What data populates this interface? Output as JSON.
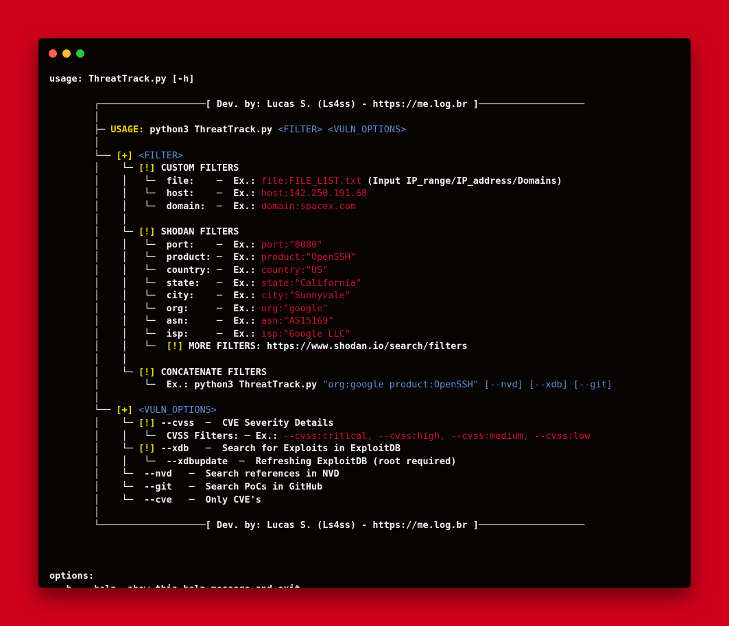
{
  "window": {
    "controls": [
      "close",
      "minimize",
      "zoom"
    ],
    "colors": {
      "close": "#ff5f57",
      "minimize": "#febc2e",
      "zoom": "#28c840"
    }
  },
  "colors": {
    "background": "#d0021b",
    "terminal": "#070302",
    "text": "#f4f4f4",
    "yellow": "#f5d90a",
    "blue": "#5a8fd6",
    "red": "#c8142c"
  },
  "terminal": {
    "lines": [
      [
        {
          "t": "usage: ThreatTrack.py [-h]",
          "c": "default"
        }
      ],
      [],
      [
        {
          "t": "        ┌───────────────────[ Dev. by: Lucas S. (Ls4ss) - https://me.log.br ]───────────────────",
          "c": "default"
        }
      ],
      [
        {
          "t": "        │",
          "c": "default"
        }
      ],
      [
        {
          "t": "        ├─ ",
          "c": "default"
        },
        {
          "t": "USAGE:",
          "c": "yellow"
        },
        {
          "t": " python3 ThreatTrack.py ",
          "c": "default"
        },
        {
          "t": "<FILTER> <VULN_OPTIONS>",
          "c": "blue"
        }
      ],
      [
        {
          "t": "        │",
          "c": "default"
        }
      ],
      [
        {
          "t": "        └── ",
          "c": "default"
        },
        {
          "t": "[+]",
          "c": "yellow"
        },
        {
          "t": " ",
          "c": "default"
        },
        {
          "t": "<FILTER>",
          "c": "blue"
        }
      ],
      [
        {
          "t": "        │    └─ ",
          "c": "default"
        },
        {
          "t": "[!]",
          "c": "yellow"
        },
        {
          "t": " CUSTOM FILTERS",
          "c": "default"
        }
      ],
      [
        {
          "t": "        │    │   └─  file:    ─  Ex.: ",
          "c": "default"
        },
        {
          "t": "file:FILE_LIST.txt",
          "c": "red"
        },
        {
          "t": " (Input IP_range/IP_address/Domains)",
          "c": "default"
        }
      ],
      [
        {
          "t": "        │    │   └─  host:    ─  Ex.: ",
          "c": "default"
        },
        {
          "t": "host:142.250.191.68",
          "c": "red"
        }
      ],
      [
        {
          "t": "        │    │   └─  domain:  ─  Ex.: ",
          "c": "default"
        },
        {
          "t": "domain:spacex.com",
          "c": "red"
        }
      ],
      [
        {
          "t": "        │    │",
          "c": "default"
        }
      ],
      [
        {
          "t": "        │    └─ ",
          "c": "default"
        },
        {
          "t": "[!]",
          "c": "yellow"
        },
        {
          "t": " SHODAN FILTERS",
          "c": "default"
        }
      ],
      [
        {
          "t": "        │    │   └─  port:    ─  Ex.: ",
          "c": "default"
        },
        {
          "t": "port:\"8080\"",
          "c": "red"
        }
      ],
      [
        {
          "t": "        │    │   └─  product: ─  Ex.: ",
          "c": "default"
        },
        {
          "t": "product:\"OpenSSH\"",
          "c": "red"
        }
      ],
      [
        {
          "t": "        │    │   └─  country: ─  Ex.: ",
          "c": "default"
        },
        {
          "t": "country:\"US\"",
          "c": "red"
        }
      ],
      [
        {
          "t": "        │    │   └─  state:   ─  Ex.: ",
          "c": "default"
        },
        {
          "t": "state:\"California\"",
          "c": "red"
        }
      ],
      [
        {
          "t": "        │    │   └─  city:    ─  Ex.: ",
          "c": "default"
        },
        {
          "t": "city:\"Sunnyvale\"",
          "c": "red"
        }
      ],
      [
        {
          "t": "        │    │   └─  org:     ─  Ex.: ",
          "c": "default"
        },
        {
          "t": "org:\"google\"",
          "c": "red"
        }
      ],
      [
        {
          "t": "        │    │   └─  asn:     ─  Ex.: ",
          "c": "default"
        },
        {
          "t": "asn:\"AS15169\"",
          "c": "red"
        }
      ],
      [
        {
          "t": "        │    │   └─  isp:     ─  Ex.: ",
          "c": "default"
        },
        {
          "t": "isp:\"Google LLC\"",
          "c": "red"
        }
      ],
      [
        {
          "t": "        │    │   └─  ",
          "c": "default"
        },
        {
          "t": "[!]",
          "c": "yellow"
        },
        {
          "t": " MORE FILTERS: https://www.shodan.io/search/filters",
          "c": "default"
        }
      ],
      [
        {
          "t": "        │    │",
          "c": "default"
        }
      ],
      [
        {
          "t": "        │    └─ ",
          "c": "default"
        },
        {
          "t": "[!]",
          "c": "yellow"
        },
        {
          "t": " CONCATENATE FILTERS",
          "c": "default"
        }
      ],
      [
        {
          "t": "        │        └─  Ex.: python3 ThreatTrack.py ",
          "c": "default"
        },
        {
          "t": "\"org:google product:OpenSSH\" [--nvd] [--xdb] [--git]",
          "c": "blue"
        }
      ],
      [
        {
          "t": "        │",
          "c": "default"
        }
      ],
      [
        {
          "t": "        └── ",
          "c": "default"
        },
        {
          "t": "[+]",
          "c": "yellow"
        },
        {
          "t": " ",
          "c": "default"
        },
        {
          "t": "<VULN_OPTIONS>",
          "c": "blue"
        }
      ],
      [
        {
          "t": "        │    └─ ",
          "c": "default"
        },
        {
          "t": "[!]",
          "c": "yellow"
        },
        {
          "t": " --cvss  ─  CVE Severity Details",
          "c": "default"
        }
      ],
      [
        {
          "t": "        │    │   └─  CVSS Filters: ─ Ex.: ",
          "c": "default"
        },
        {
          "t": "--cvss:critical, --cvss:high, --cvss:medium, --cvss:low",
          "c": "red"
        }
      ],
      [
        {
          "t": "        │    └─ ",
          "c": "default"
        },
        {
          "t": "[!]",
          "c": "yellow"
        },
        {
          "t": " --xdb   ─  Search for Exploits in ExploitDB",
          "c": "default"
        }
      ],
      [
        {
          "t": "        │    │   └─  --xdbupdate  ─  Refreshing ExploitDB (root required)",
          "c": "default"
        }
      ],
      [
        {
          "t": "        │    └─  --nvd   ─  Search references in NVD",
          "c": "default"
        }
      ],
      [
        {
          "t": "        │    └─  --git   ─  Search PoCs in GitHub",
          "c": "default"
        }
      ],
      [
        {
          "t": "        │    └─  --cve   ─  Only CVE's",
          "c": "default"
        }
      ],
      [
        {
          "t": "        │",
          "c": "default"
        }
      ],
      [
        {
          "t": "        └───────────────────[ Dev. by: Lucas S. (Ls4ss) - https://me.log.br ]───────────────────",
          "c": "default"
        }
      ],
      [],
      [],
      [],
      [
        {
          "t": "options:",
          "c": "default"
        }
      ],
      [
        {
          "t": "  -h, --help  show this help message and exit",
          "c": "default"
        }
      ]
    ]
  }
}
